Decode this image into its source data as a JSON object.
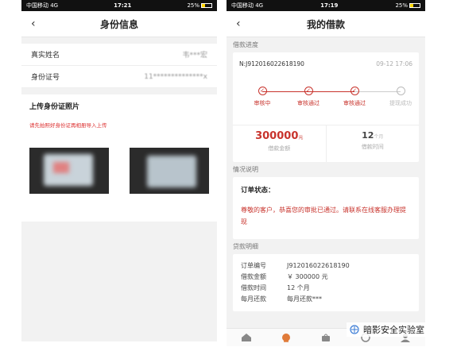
{
  "left_screen": {
    "status": {
      "carrier": "中国移动 4G",
      "time": "17:21",
      "battery": "25%"
    },
    "title": "身份信息",
    "name_label": "真实姓名",
    "name_value": "韦***宏",
    "id_label": "身份证号",
    "id_value": "11**************x",
    "upload_title": "上传身份证照片",
    "upload_hint": "请先拍照好身份证再相册导入上传"
  },
  "right_screen": {
    "status": {
      "carrier": "中国移动 4G",
      "time": "17:19",
      "battery": "25%"
    },
    "title": "我的借款",
    "progress_section": "借款进度",
    "order_no": "N:J912016022618190",
    "order_date": "09-12 17:06",
    "steps": [
      {
        "label": "审核中",
        "done": true
      },
      {
        "label": "审核通过",
        "done": true
      },
      {
        "label": "审核通过",
        "done": true
      },
      {
        "label": "提现成功",
        "done": false
      }
    ],
    "amount_value": "300000",
    "amount_unit": "元",
    "amount_label": "借款金额",
    "period_value": "12",
    "period_unit": "个月",
    "period_label": "借款时间",
    "status_section": "情况说明",
    "status_title": "订单状态：",
    "status_message": "尊敬的客户，恭喜您的审批已通过。请联系在线客服办理提现",
    "detail_section": "贷款明细",
    "details": [
      {
        "k": "订单编号",
        "v": "J912016022618190"
      },
      {
        "k": "借款金额",
        "v": "￥ 300000 元"
      },
      {
        "k": "借款时间",
        "v": "12 个月"
      },
      {
        "k": "每月还款",
        "v": "每月还款***"
      }
    ],
    "tab_icons": [
      "home-icon",
      "loan-icon",
      "bag-icon",
      "service-icon",
      "user-icon"
    ]
  },
  "watermark": "暗影安全实验室",
  "colors": {
    "accent": "#c8332c",
    "background": "#f2f2f2"
  }
}
